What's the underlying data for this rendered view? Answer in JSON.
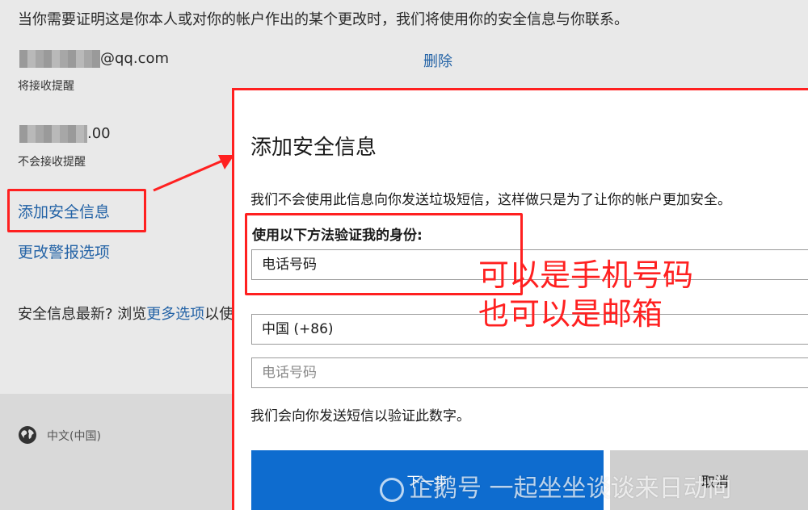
{
  "background": {
    "intro": "当你需要证明这是你本人或对你的帐户作出的某个更改时，我们将使用你的安全信息与你联系。",
    "accounts": [
      {
        "value_suffix": "@qq.com",
        "note": "将接收提醒",
        "action": "删除"
      },
      {
        "value_suffix": ".00",
        "note": "不会接收提醒"
      }
    ],
    "add_security_info": "添加安全信息",
    "change_alert_options": "更改警报选项",
    "latest_prefix": "安全信息最新? 浏览",
    "latest_link": "更多选项",
    "latest_suffix": "以使",
    "language": "中文(中国)"
  },
  "dialog": {
    "title": "添加安全信息",
    "note": "我们不会使用此信息向你发送垃圾短信，这样做只是为了让你的帐户更加安全。",
    "verify_label": "使用以下方法验证我的身份:",
    "method_value": "电话号码",
    "country_value": "中国 (+86)",
    "phone_placeholder": "电话号码",
    "sms_note": "我们会向你发送短信以验证此数字。",
    "next_button": "下一步",
    "cancel_button": "取消"
  },
  "annotations": {
    "line1": "可以是手机号码",
    "line2": "也可以是邮箱"
  },
  "watermark": "企鹅号 一起坐坐谈谈来日动向",
  "colors": {
    "link": "#2463a6",
    "primary_button": "#0e6ccf",
    "annotation_red": "#ff2020"
  }
}
